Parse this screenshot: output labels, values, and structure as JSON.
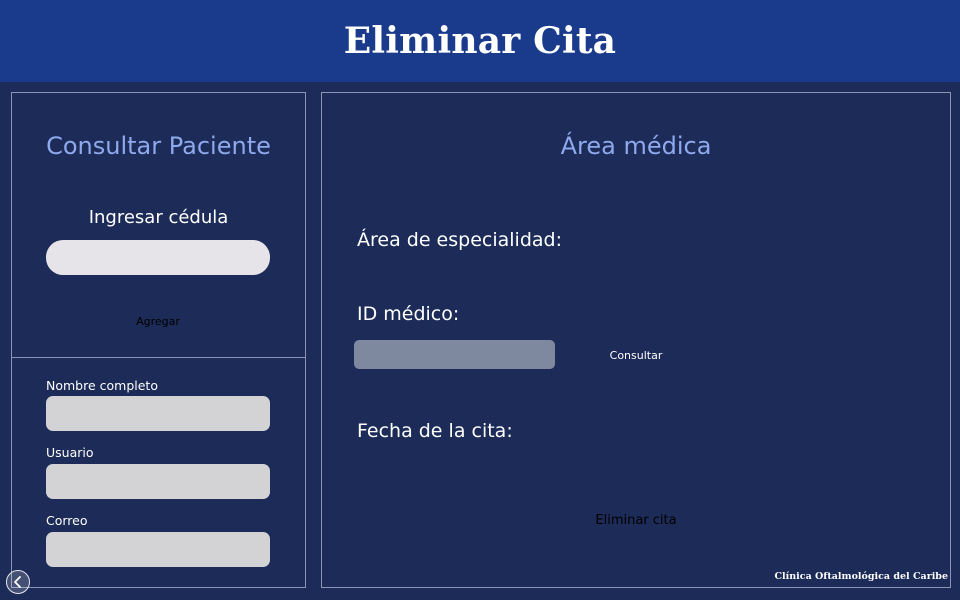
{
  "header": {
    "title": "Eliminar Cita"
  },
  "left_panel": {
    "title": "Consultar Paciente",
    "cedula_label": "Ingresar cédula",
    "cedula_value": "",
    "add_button_label": "Agregar",
    "fields": [
      {
        "label": "Nombre completo",
        "value": ""
      },
      {
        "label": "Usuario",
        "value": ""
      },
      {
        "label": "Correo",
        "value": ""
      }
    ]
  },
  "right_panel": {
    "title": "Área médica",
    "specialty_label": "Área de especialidad:",
    "doctor_id_label": "ID médico:",
    "doctor_id_value": "",
    "consult_button_label": "Consultar",
    "date_label": "Fecha de la cita:",
    "delete_button_label": "Eliminar cita"
  },
  "footer": {
    "brand": "Clínica Oftalmológica del Caribe",
    "back_icon": "chevron-left-icon"
  },
  "colors": {
    "background": "#1c2b57",
    "header": "#1a3a8c",
    "title_accent": "#8ea9ee",
    "panel_border": "#8a95b5"
  }
}
